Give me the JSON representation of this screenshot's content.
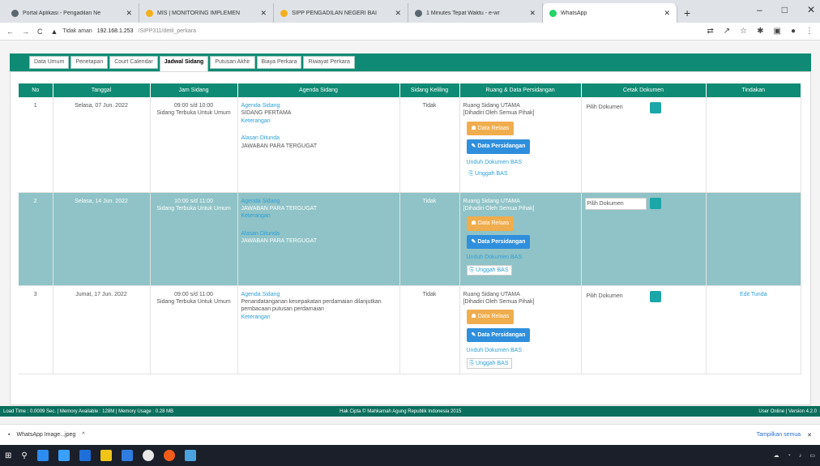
{
  "browser": {
    "tabs": [
      {
        "label": "Portal Aplikasi - Pengadilan Ne",
        "color": "#5b6770"
      },
      {
        "label": "MIS | MONITORING IMPLEMEN",
        "color": "#f2b01e"
      },
      {
        "label": "SIPP PENGADILAN NEGERI BAI",
        "color": "#f2b01e"
      },
      {
        "label": "1 Minutes Tepat Waktu - e-wr",
        "color": "#5b6770"
      },
      {
        "label": "WhatsApp",
        "color": "#25d366"
      }
    ],
    "url_warning": "Tidak aman",
    "url_host": "192.168.1.253",
    "url_path": "/SIPP311/detil_perkara"
  },
  "perkara_tabs": [
    "Data Umum",
    "Penetapan",
    "Court Calendar",
    "Jadwal Sidang",
    "Putusan Akhir",
    "Biaya Perkara",
    "Riwayat Perkara"
  ],
  "active_tab": "Jadwal Sidang",
  "table": {
    "headers": [
      "No",
      "Tanggal",
      "Jam Sidang",
      "Agenda Sidang",
      "Sidang Keliling",
      "Ruang & Data Persidangan",
      "Cetak Dokumen",
      "Tindakan"
    ],
    "rows": [
      {
        "no": "1",
        "tanggal": "Selasa, 07 Jun. 2022",
        "jam": "09:00 s/d 10:00",
        "jam_note": "Sidang Terbuka Untuk Umum",
        "agenda_label": "Agenda Sidang",
        "agenda": "SIDANG PERTAMA",
        "keterangan": "Keterangan",
        "alasan_label": "Alasan Ditunda",
        "alasan": "JAWABAN PARA TERGUGAT",
        "keliling": "Tidak",
        "ruang": "Ruang Sidang UTAMA",
        "ruang_note": "[Dihadiri Oleh Semua Pihak]",
        "btn_relaas": "Data Relaas",
        "btn_persidangan": "Data Persidangan",
        "unduh": "Unduh Dokumen BAS",
        "unggah": "Unggah BAS",
        "cetak": "Pilih Dokumen",
        "tindakan": ""
      },
      {
        "no": "2",
        "tanggal": "Selasa, 14 Jun. 2022",
        "jam": "10:00 s/d 11:00",
        "jam_note": "Sidang Terbuka Untuk Umum",
        "agenda_label": "Agenda Sidang",
        "agenda": "JAWABAN PARA TERGUGAT",
        "keterangan": "Keterangan",
        "alasan_label": "Alasan Ditunda",
        "alasan": "JAWABAN PARA TERGUGAT",
        "keliling": "Tidak",
        "ruang": "Ruang Sidang UTAMA",
        "ruang_note": "[Dihadiri Oleh Semua Pihak]",
        "btn_relaas": "Data Relaas",
        "btn_persidangan": "Data Persidangan",
        "unduh": "Unduh Dokumen BAS",
        "unggah": "Unggah BAS",
        "cetak": "Pilih Dokumen",
        "tindakan": ""
      },
      {
        "no": "3",
        "tanggal": "Jumat, 17 Jun. 2022",
        "jam": "09:00 s/d 11:00",
        "jam_note": "Sidang Terbuka Untuk Umum",
        "agenda_label": "Agenda Sidang",
        "agenda": "Penandatanganan kesepakatan perdamaian dilanjutkan pembacaan putusan perdamaian",
        "keterangan": "Keterangan",
        "alasan_label": "",
        "alasan": "",
        "keliling": "Tidak",
        "ruang": "Ruang Sidang UTAMA",
        "ruang_note": "[Dihadiri Oleh Semua Pihak]",
        "btn_relaas": "Data Relaas",
        "btn_persidangan": "Data Persidangan",
        "unduh": "Unduh Dokumen BAS",
        "unggah": "Unggah BAS",
        "cetak": "Pilih Dokumen",
        "tindakan": "Edit Tunda"
      }
    ]
  },
  "footer": {
    "left": "Load Time : 0.0009 Sec. | Memory Available : 128M | Memory Usage : 0.28 MB",
    "center": "Hak Cipta © Mahkamah Agung Republik Indonesia 2015",
    "right": "User Online | Version 4.2.0"
  },
  "download": {
    "file": "WhatsApp Image...jpeg",
    "show_all": "Tampilkan semua"
  }
}
